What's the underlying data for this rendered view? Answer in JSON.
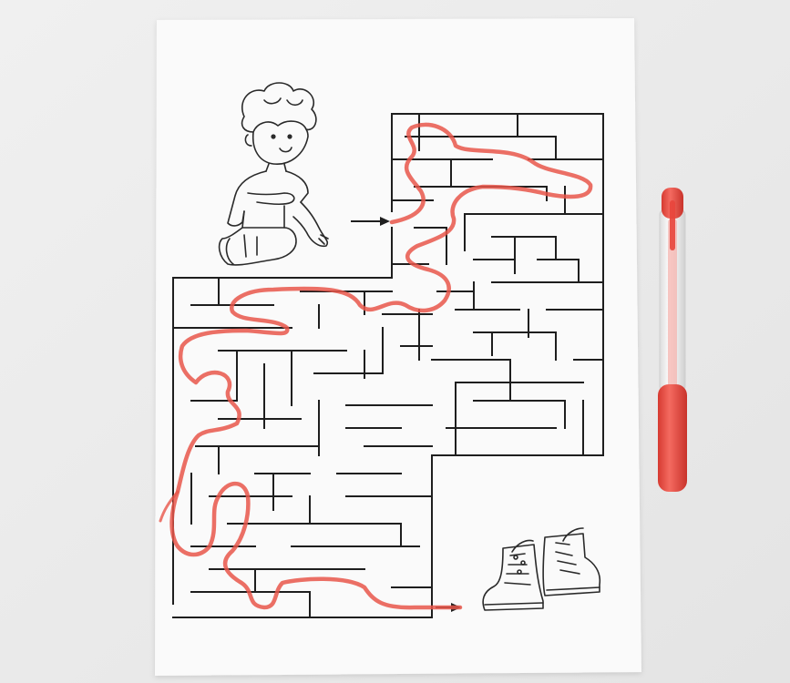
{
  "scene": {
    "background_color": "#ebebeb",
    "paper_color": "#fafafa",
    "ink_color": "#1e1e1e",
    "path_color": "#e8564a",
    "pen": {
      "body_color": "#f2f2f2",
      "cap_color": "#e8453c",
      "grip_color": "#e8453c"
    },
    "illustrations": [
      "boy-drawing",
      "boots-drawing",
      "maze-start-arrow",
      "maze-end-arrow",
      "red-marker-pen"
    ]
  }
}
